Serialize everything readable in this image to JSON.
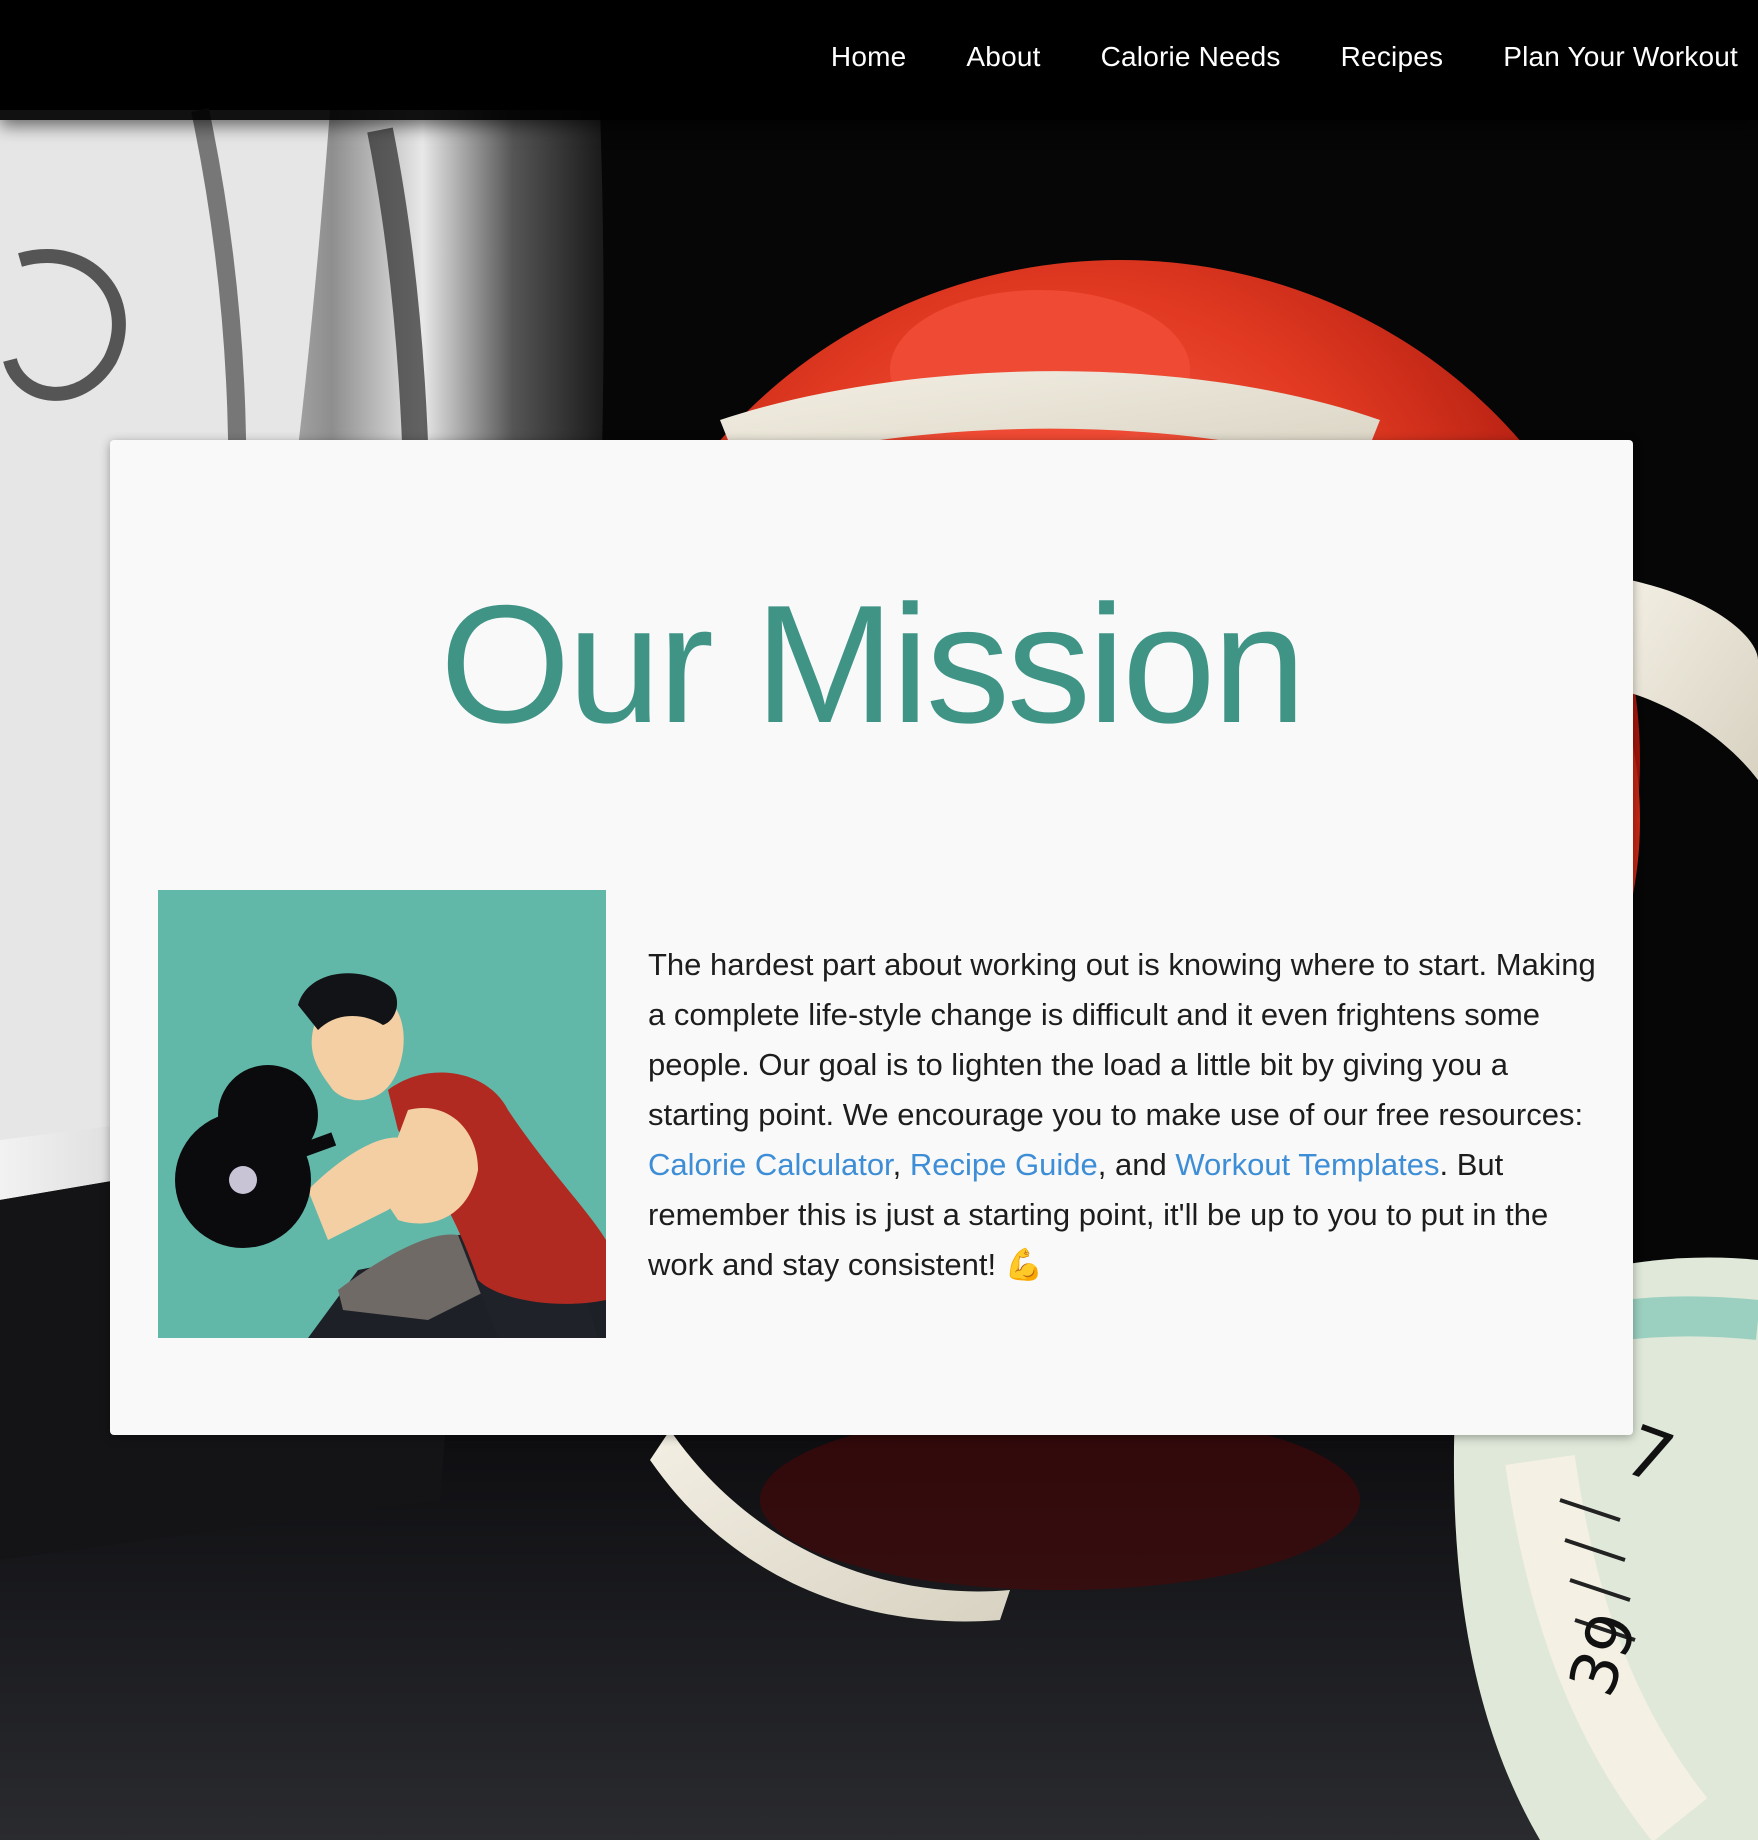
{
  "nav": {
    "items": [
      {
        "label": "Home"
      },
      {
        "label": "About"
      },
      {
        "label": "Calorie Needs"
      },
      {
        "label": "Recipes"
      },
      {
        "label": "Plan Your Workout"
      }
    ]
  },
  "mission": {
    "title": "Our Mission",
    "paragraph": {
      "intro": "The hardest part about working out is knowing where to start. Making a complete life-style change is difficult and it even frightens some people. Our goal is to lighten the load a little bit by giving you a starting point. We encourage you to make use of our free resources: ",
      "link_calorie": "Calorie Calculator",
      "sep1": ", ",
      "link_recipe": "Recipe Guide",
      "sep2": ", and ",
      "link_workout": "Workout Templates",
      "outro": ". But remember this is just a starting point, it'll be up to you to put in the work and stay consistent! ",
      "emoji": "💪"
    },
    "illustration_icon": "weightlifter-illustration"
  },
  "background_icon": "dumbbell-apple-measuring-tape-photo",
  "colors": {
    "title": "#3f9486",
    "link": "#3d8ed6",
    "illustration_bg": "#62b8a8",
    "navbar": "#000000",
    "card": "#f9f9f9"
  }
}
